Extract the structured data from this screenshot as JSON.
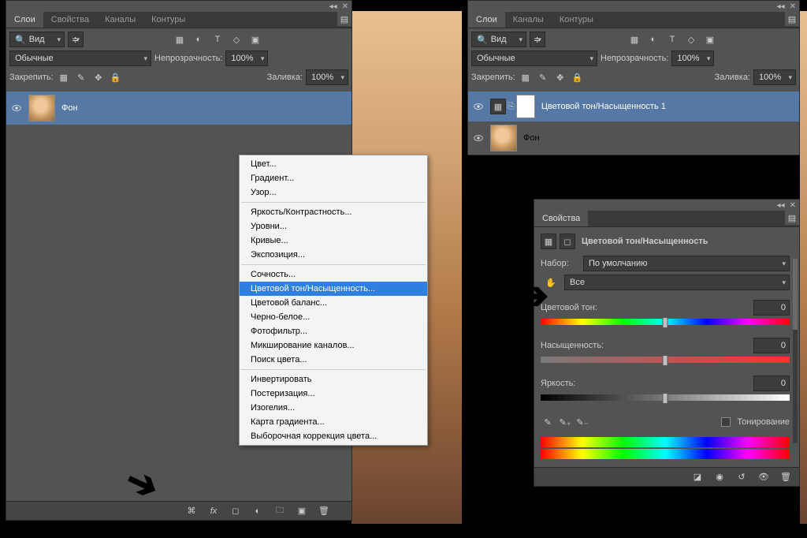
{
  "left_panel": {
    "tabs": [
      "Слои",
      "Свойства",
      "Каналы",
      "Контуры"
    ],
    "active_tab": 0,
    "filter_mode": "Вид",
    "blend_mode": "Обычные",
    "opacity_label": "Непрозрачность:",
    "opacity_value": "100%",
    "lock_label": "Закрепить:",
    "fill_label": "Заливка:",
    "fill_value": "100%",
    "layers": [
      {
        "name": "Фон"
      }
    ]
  },
  "right_layers_panel": {
    "tabs": [
      "Слои",
      "Каналы",
      "Контуры"
    ],
    "active_tab": 0,
    "filter_mode": "Вид",
    "blend_mode": "Обычные",
    "opacity_label": "Непрозрачность:",
    "opacity_value": "100%",
    "lock_label": "Закрепить:",
    "fill_label": "Заливка:",
    "fill_value": "100%",
    "layers": [
      {
        "name": "Цветовой тон/Насыщенность 1"
      },
      {
        "name": "Фон"
      }
    ]
  },
  "properties_panel": {
    "tab": "Свойства",
    "title": "Цветовой тон/Насыщенность",
    "preset_label": "Набор:",
    "preset_value": "По умолчанию",
    "channel_value": "Все",
    "hue_label": "Цветовой тон:",
    "hue_value": "0",
    "sat_label": "Насыщенность:",
    "sat_value": "0",
    "light_label": "Яркость:",
    "light_value": "0",
    "colorize_label": "Тонирование"
  },
  "adjustment_menu": {
    "groups": [
      [
        "Цвет...",
        "Градиент...",
        "Узор..."
      ],
      [
        "Яркость/Контрастность...",
        "Уровни...",
        "Кривые...",
        "Экспозиция..."
      ],
      [
        "Сочность...",
        "Цветовой тон/Насыщенность...",
        "Цветовой баланс...",
        "Черно-белое...",
        "Фотофильтр...",
        "Микширование каналов...",
        "Поиск цвета..."
      ],
      [
        "Инвертировать",
        "Постеризация...",
        "Изогелия...",
        "Карта градиента...",
        "Выборочная коррекция цвета..."
      ]
    ],
    "highlighted": "Цветовой тон/Насыщенность..."
  }
}
